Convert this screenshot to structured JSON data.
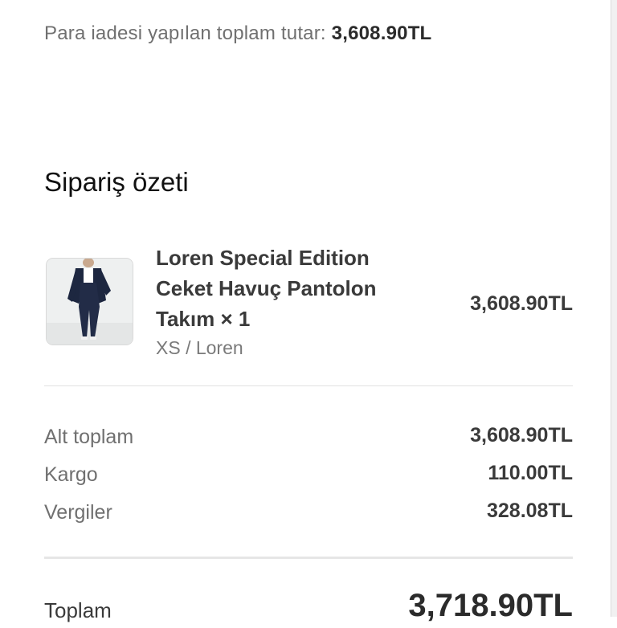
{
  "refund": {
    "label": "Para iadesi yapılan toplam tutar:",
    "amount": "3,608.90TL"
  },
  "summary": {
    "title": "Sipariş özeti"
  },
  "product": {
    "name": "Loren Special Edition Ceket Havuç Pantolon Takım × 1",
    "variant": "XS / Loren",
    "price": "3,608.90TL",
    "image_icon": "product-photo-navy-suit"
  },
  "totals": {
    "subtotal_label": "Alt toplam",
    "subtotal_value": "3,608.90TL",
    "shipping_label": "Kargo",
    "shipping_value": "110.00TL",
    "taxes_label": "Vergiler",
    "taxes_value": "328.08TL",
    "total_label": "Toplam",
    "total_value": "3,718.90TL"
  },
  "colors": {
    "text_primary": "#111111",
    "text_secondary": "#707070",
    "divider": "#e2e2e2",
    "suit_navy": "#1d2740"
  }
}
